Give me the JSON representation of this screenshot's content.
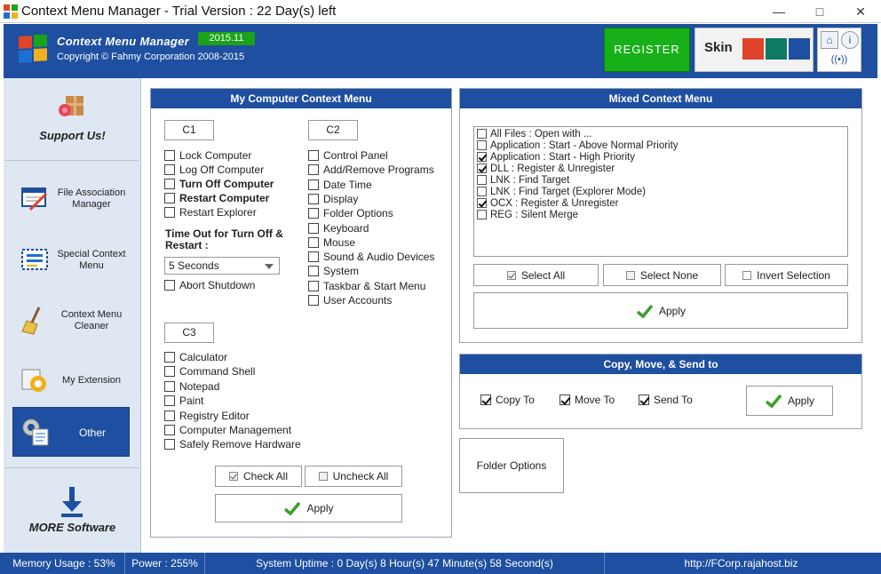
{
  "window": {
    "title": "Context Menu Manager - Trial Version : 22 Day(s) left",
    "minimize_glyph": "—",
    "maximize_glyph": "□",
    "close_glyph": "✕"
  },
  "header": {
    "product_name": "Context Menu Manager",
    "version": "2015.11",
    "copyright": "Copyright © Fahmy Corporation 2008-2015",
    "register_label": "REGISTER",
    "skin_label": "Skin",
    "skin_colors": [
      "#e0442a",
      "#0f7a63",
      "#1e4fa0"
    ],
    "icons": [
      "home-icon",
      "info-icon",
      "broadcast-icon"
    ]
  },
  "sidebar": {
    "support_label": "Support Us!",
    "items": [
      {
        "label": "File Association Manager",
        "icon": "file-association-icon"
      },
      {
        "label": "Special Context Menu",
        "icon": "special-menu-icon"
      },
      {
        "label": "Context Menu Cleaner",
        "icon": "broom-icon"
      },
      {
        "label": "My Extension",
        "icon": "gear-folder-icon"
      },
      {
        "label": "Other",
        "icon": "gear-document-icon",
        "active": true
      }
    ],
    "more_label": "MORE Software"
  },
  "my_computer": {
    "title": "My Computer Context Menu",
    "c1": {
      "label": "C1",
      "items": [
        {
          "label": "Lock Computer",
          "bold": false
        },
        {
          "label": "Log Off Computer",
          "bold": false
        },
        {
          "label": "Turn Off Computer",
          "bold": true
        },
        {
          "label": "Restart Computer",
          "bold": true
        },
        {
          "label": "Restart Explorer",
          "bold": false
        }
      ]
    },
    "timeout_label": "Time Out for Turn Off & Restart :",
    "timeout_value": "5 Seconds",
    "abort_label": "Abort Shutdown",
    "c2": {
      "label": "C2",
      "items": [
        "Control Panel",
        "Add/Remove Programs",
        "Date Time",
        "Display",
        "Folder Options",
        "Keyboard",
        "Mouse",
        "Sound & Audio Devices",
        "System",
        "Taskbar & Start Menu",
        "User Accounts"
      ]
    },
    "c3": {
      "label": "C3",
      "items": [
        "Calculator",
        "Command Shell",
        "Notepad",
        "Paint",
        "Registry Editor",
        "Computer Management",
        "Safely Remove Hardware"
      ]
    },
    "check_all": "Check All",
    "uncheck_all": "Uncheck All",
    "apply": "Apply"
  },
  "mixed": {
    "title": "Mixed Context Menu",
    "items": [
      {
        "label": "All Files : Open with ...",
        "checked": false
      },
      {
        "label": "Application : Start - Above Normal Priority",
        "checked": false
      },
      {
        "label": "Application : Start - High Priority",
        "checked": true
      },
      {
        "label": "DLL : Register & Unregister",
        "checked": true
      },
      {
        "label": "LNK : Find Target",
        "checked": false
      },
      {
        "label": "LNK : Find Target (Explorer Mode)",
        "checked": false
      },
      {
        "label": "OCX : Register & Unregister",
        "checked": true
      },
      {
        "label": "REG : Silent Merge",
        "checked": false
      }
    ],
    "select_all": "Select All",
    "select_none": "Select None",
    "invert_selection": "Invert Selection",
    "apply": "Apply"
  },
  "copy_move": {
    "title": "Copy, Move, & Send to",
    "items": [
      {
        "label": "Copy To",
        "checked": true
      },
      {
        "label": "Move To",
        "checked": true
      },
      {
        "label": "Send To",
        "checked": true
      }
    ],
    "apply": "Apply"
  },
  "folder_options_button": "Folder Options",
  "statusbar": {
    "memory": "Memory Usage : 53%",
    "power": "Power : 255%",
    "uptime": "System Uptime : 0 Day(s) 8 Hour(s) 47 Minute(s) 58 Second(s)",
    "url": "http://FCorp.rajahost.biz"
  }
}
